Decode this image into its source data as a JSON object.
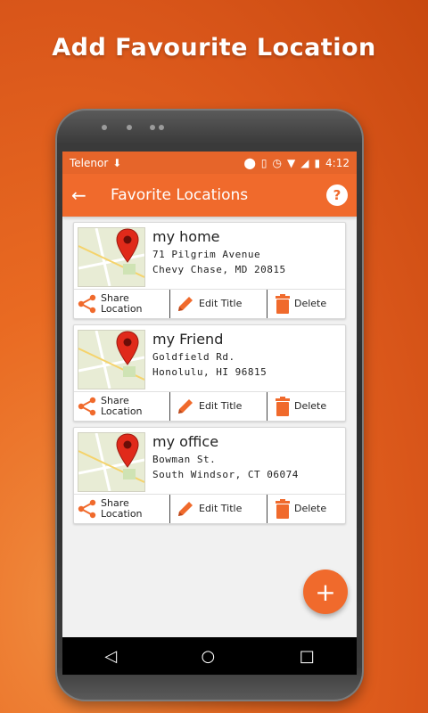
{
  "promo": {
    "title": "Add Favourite Location"
  },
  "status_bar": {
    "carrier": "Telenor",
    "time": "4:12"
  },
  "toolbar": {
    "title": "Favorite Locations",
    "help_label": "?"
  },
  "actions": {
    "share_line1": "Share",
    "share_line2": "Location",
    "edit": "Edit Title",
    "delete": "Delete"
  },
  "locations": [
    {
      "title": "my home",
      "line1": "71 Pilgrim Avenue",
      "line2": "Chevy Chase, MD 20815"
    },
    {
      "title": "my Friend",
      "line1": "Goldfield Rd.",
      "line2": "Honolulu, HI 96815"
    },
    {
      "title": "my office",
      "line1": "Bowman St.",
      "line2": "South Windsor, CT 06074"
    }
  ],
  "fab": {
    "label": "+"
  },
  "colors": {
    "accent": "#f06a2c",
    "statusbar": "#e6652a",
    "background": "#e96a22"
  },
  "icons": {
    "back": "arrow-left-icon",
    "help": "help-icon",
    "share": "share-icon",
    "edit": "pencil-icon",
    "delete": "trash-icon",
    "pin": "map-pin-icon"
  }
}
